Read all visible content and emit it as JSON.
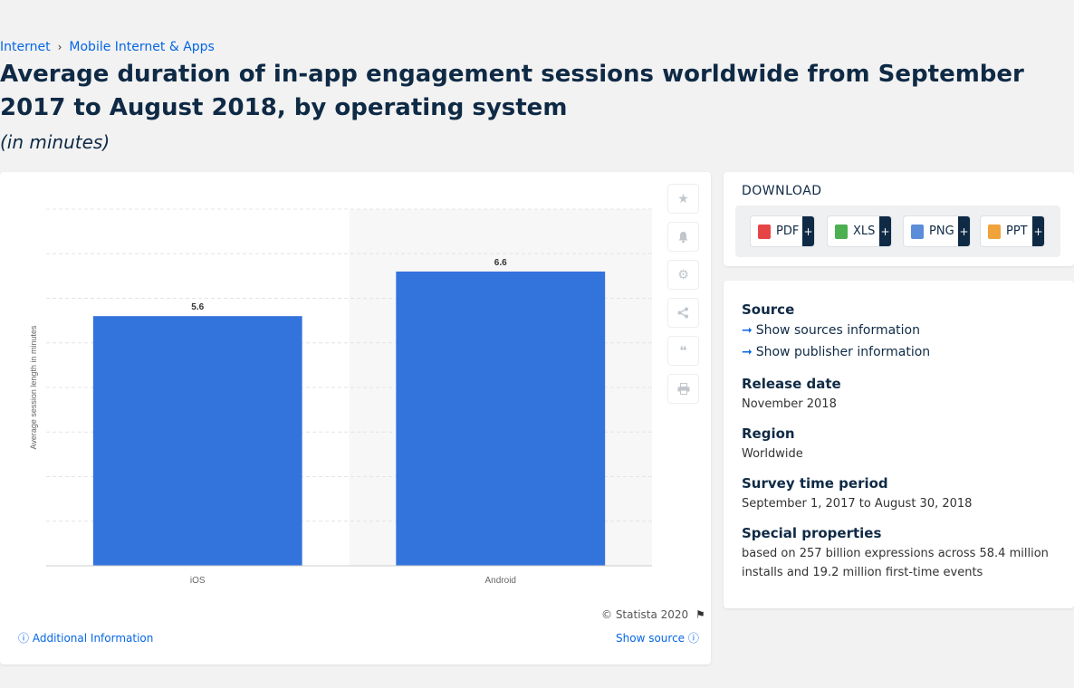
{
  "breadcrumb": {
    "item1": "Internet",
    "separator": "›",
    "item2": "Mobile Internet & Apps"
  },
  "title": "Average duration of in-app engagement sessions worldwide from September 2017 to August 2018, by operating system",
  "subtitle": "(in minutes)",
  "chart_data": {
    "type": "bar",
    "categories": [
      "iOS",
      "Android"
    ],
    "values": [
      5.6,
      6.6
    ],
    "data_labels": [
      "5.6",
      "6.6"
    ],
    "ylabel": "Average session length in minutes",
    "xlabel": "",
    "ylim": [
      0,
      8
    ],
    "grid": true,
    "bar_color": "#3373dc",
    "alt_band_color": "#f7f7f7"
  },
  "toolbar": {
    "favorite_icon": "star-icon",
    "alert_icon": "bell-icon",
    "settings_icon": "gear-icon",
    "share_icon": "share-icon",
    "cite_icon": "quote-icon",
    "print_icon": "print-icon"
  },
  "footer": {
    "copyright": "© Statista 2020",
    "additional_info": "Additional Information",
    "show_source": "Show source"
  },
  "download": {
    "title": "DOWNLOAD",
    "buttons": [
      {
        "label": "PDF",
        "icon": "pdf-icon",
        "color": "#e64545"
      },
      {
        "label": "XLS",
        "icon": "xls-icon",
        "color": "#4caf50"
      },
      {
        "label": "PNG",
        "icon": "png-icon",
        "color": "#5b8dd9"
      },
      {
        "label": "PPT",
        "icon": "ppt-icon",
        "color": "#f0a23b"
      }
    ],
    "plus": "+"
  },
  "info": {
    "source_label": "Source",
    "show_sources": "Show sources information",
    "show_publisher": "Show publisher information",
    "release_label": "Release date",
    "release_value": "November 2018",
    "region_label": "Region",
    "region_value": "Worldwide",
    "survey_label": "Survey time period",
    "survey_value": "September 1, 2017 to August 30, 2018",
    "special_label": "Special properties",
    "special_value": "based on 257 billion expressions across 58.4 million installs and 19.2 million first-time events"
  },
  "colors": {
    "accent": "#0666e5",
    "navy": "#0f2a45"
  }
}
